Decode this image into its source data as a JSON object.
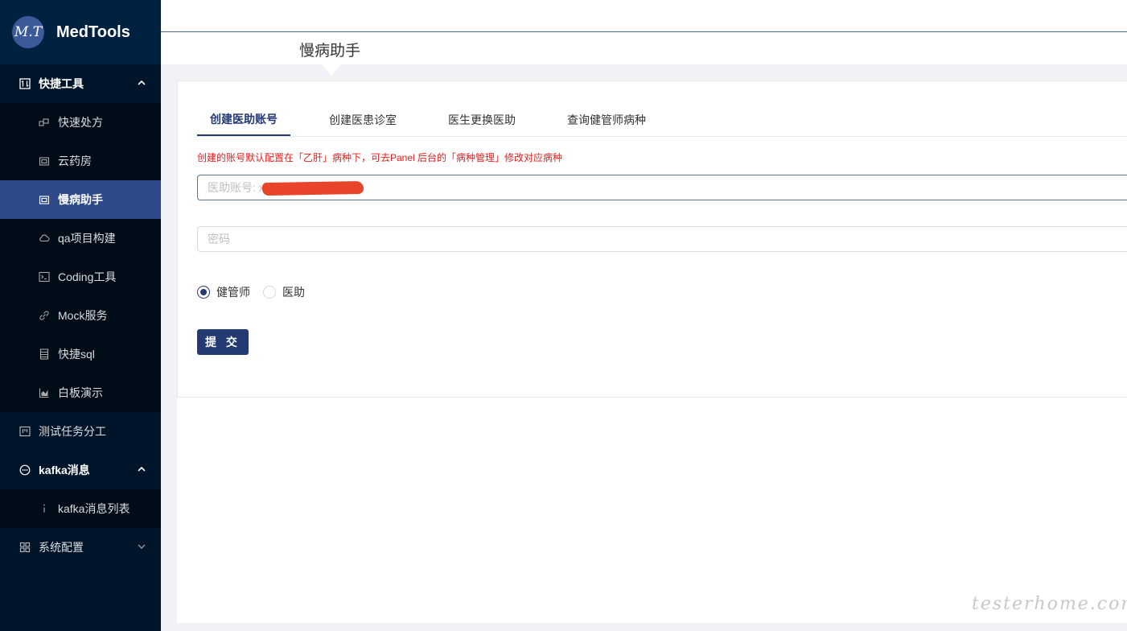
{
  "app": {
    "logo_badge": "M.T",
    "name": "MedTools"
  },
  "sidebar": {
    "groups": [
      {
        "label": "快捷工具",
        "icon": "tool-icon",
        "expanded": true,
        "items": [
          {
            "label": "快速处方",
            "icon": "prescription-icon"
          },
          {
            "label": "云药房",
            "icon": "pharmacy-icon"
          },
          {
            "label": "慢病助手",
            "icon": "assistant-icon",
            "active": true
          },
          {
            "label": "qa项目构建",
            "icon": "cloud-icon"
          },
          {
            "label": "Coding工具",
            "icon": "terminal-icon"
          },
          {
            "label": "Mock服务",
            "icon": "link-icon"
          },
          {
            "label": "快捷sql",
            "icon": "database-icon"
          },
          {
            "label": "白板演示",
            "icon": "chart-icon"
          }
        ]
      },
      {
        "label": "测试任务分工",
        "icon": "board-icon",
        "expanded": false,
        "items": []
      },
      {
        "label": "kafka消息",
        "icon": "message-icon",
        "expanded": true,
        "items": [
          {
            "label": "kafka消息列表",
            "icon": "info-icon"
          }
        ]
      },
      {
        "label": "系统配置",
        "icon": "appstore-icon",
        "expanded": false,
        "items": []
      }
    ]
  },
  "page": {
    "title": "慢病助手"
  },
  "tabs": [
    {
      "label": "创建医助账号",
      "active": true
    },
    {
      "label": "创建医患诊室",
      "active": false
    },
    {
      "label": "医生更换医助",
      "active": false
    },
    {
      "label": "查询健管师病种",
      "active": false
    }
  ],
  "form": {
    "notice": "创建的账号默认配置在「乙肝」病种下，可去Panel 后台的「病种管理」修改对应病种",
    "account_placeholder": "医助账号: xx@",
    "password_placeholder": "密码",
    "roles": [
      {
        "label": "健管师",
        "checked": true
      },
      {
        "label": "医助",
        "checked": false
      }
    ],
    "submit_label": "提 交"
  },
  "watermark": "testerhome.com",
  "colors": {
    "sidebar_bg": "#001529",
    "active_item": "#2f4a8a",
    "primary": "#243a73",
    "notice": "#e02020"
  }
}
